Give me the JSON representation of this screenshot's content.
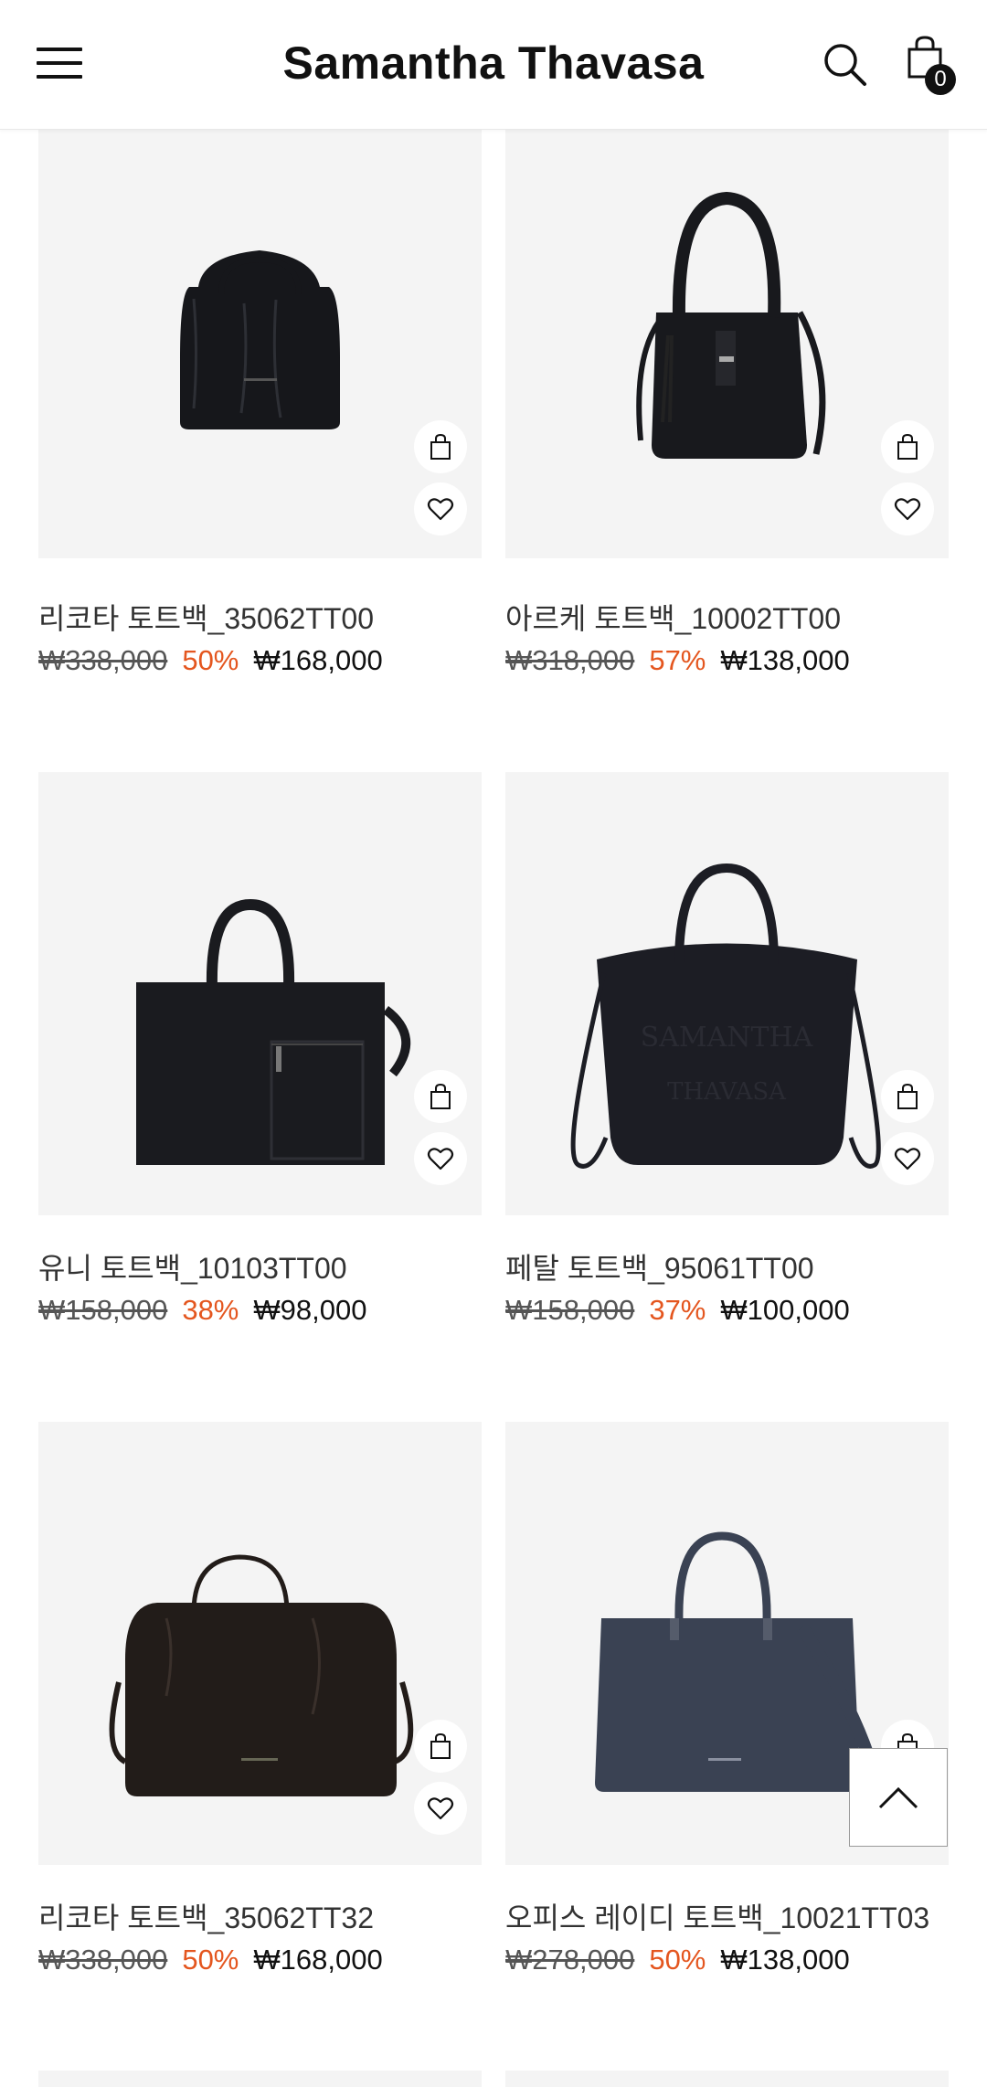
{
  "header": {
    "brand": "Samantha Thavasa",
    "cart_count": "0"
  },
  "products": [
    {
      "name": "리코타 토트백_35062TT00",
      "original_price": "₩338,000",
      "discount": "50%",
      "price": "₩168,000",
      "bag_color": "#16171b"
    },
    {
      "name": "아르케 토트백_10002TT00",
      "original_price": "₩318,000",
      "discount": "57%",
      "price": "₩138,000",
      "bag_color": "#18191d"
    },
    {
      "name": "유니 토트백_10103TT00",
      "original_price": "₩158,000",
      "discount": "38%",
      "price": "₩98,000",
      "bag_color": "#1a1b1f"
    },
    {
      "name": "페탈 토트백_95061TT00",
      "original_price": "₩158,000",
      "discount": "37%",
      "price": "₩100,000",
      "bag_color": "#1c1d24"
    },
    {
      "name": "리코타 토트백_35062TT32",
      "original_price": "₩338,000",
      "discount": "50%",
      "price": "₩168,000",
      "bag_color": "#221c19"
    },
    {
      "name": "오피스 레이디 토트백_10021TT03",
      "original_price": "₩278,000",
      "discount": "50%",
      "price": "₩138,000",
      "bag_color": "#3a4253"
    }
  ],
  "colors": {
    "discount": "#e4561f",
    "image_bg": "#f4f4f4",
    "text": "#333333"
  },
  "icons": {
    "menu": "hamburger-icon",
    "search": "search-icon",
    "cart": "shopping-bag-icon",
    "like": "heart-icon",
    "scroll_top": "chevron-up-icon"
  }
}
